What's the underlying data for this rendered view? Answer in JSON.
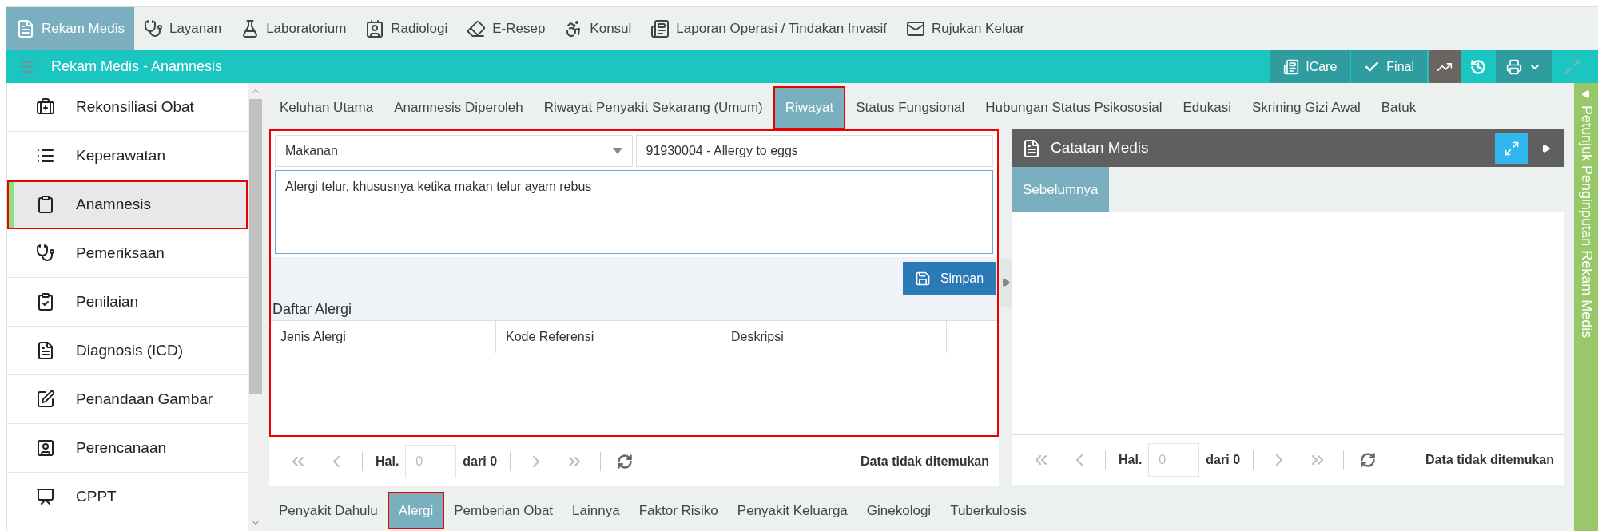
{
  "nav": [
    {
      "label": "Rekam Medis",
      "selected": true
    },
    {
      "label": "Layanan",
      "selected": false
    },
    {
      "label": "Laboratorium",
      "selected": false
    },
    {
      "label": "Radiologi",
      "selected": false
    },
    {
      "label": "E-Resep",
      "selected": false
    },
    {
      "label": "Konsul",
      "selected": false
    },
    {
      "label": "Laporan Operasi / Tindakan Invasif",
      "selected": false
    },
    {
      "label": "Rujukan Keluar",
      "selected": false
    }
  ],
  "header": {
    "title": "Rekam Medis - Anamnesis",
    "buttons": [
      "ICare",
      "Final"
    ]
  },
  "sidebar": {
    "items": [
      {
        "label": "Rekonsiliasi Obat",
        "selected": false
      },
      {
        "label": "Keperawatan",
        "selected": false
      },
      {
        "label": "Anamnesis",
        "selected": true
      },
      {
        "label": "Pemeriksaan",
        "selected": false
      },
      {
        "label": "Penilaian",
        "selected": false
      },
      {
        "label": "Diagnosis (ICD)",
        "selected": false
      },
      {
        "label": "Penandaan Gambar",
        "selected": false
      },
      {
        "label": "Perencanaan",
        "selected": false
      },
      {
        "label": "CPPT",
        "selected": false
      }
    ]
  },
  "tabs": [
    {
      "label": "Keluhan Utama",
      "selected": false
    },
    {
      "label": "Anamnesis Diperoleh",
      "selected": false
    },
    {
      "label": "Riwayat Penyakit Sekarang (Umum)",
      "selected": false
    },
    {
      "label": "Riwayat",
      "selected": true
    },
    {
      "label": "Status Fungsional",
      "selected": false
    },
    {
      "label": "Hubungan Status Psikososial",
      "selected": false
    },
    {
      "label": "Edukasi",
      "selected": false
    },
    {
      "label": "Skrining Gizi Awal",
      "selected": false
    },
    {
      "label": "Batuk",
      "selected": false
    }
  ],
  "form": {
    "type": "Makanan",
    "reference": "91930004 - Allergy to eggs",
    "description": "Alergi telur, khususnya ketika makan telur ayam rebus",
    "save": "Simpan"
  },
  "allergy_list": {
    "title": "Daftar Alergi",
    "columns": [
      "Jenis Alergi",
      "Kode Referensi",
      "Deskripsi"
    ]
  },
  "pagination": {
    "page_label": "Hal.",
    "page": "0",
    "of": "dari 0",
    "status": "Data tidak ditemukan"
  },
  "sub_tabs": [
    {
      "label": "Penyakit Dahulu",
      "selected": false
    },
    {
      "label": "Alergi",
      "selected": true
    },
    {
      "label": "Pemberian Obat",
      "selected": false
    },
    {
      "label": "Lainnya",
      "selected": false
    },
    {
      "label": "Faktor Risiko",
      "selected": false
    },
    {
      "label": "Penyakit Keluarga",
      "selected": false
    },
    {
      "label": "Ginekologi",
      "selected": false
    },
    {
      "label": "Tuberkulosis",
      "selected": false
    }
  ],
  "notes": {
    "title": "Catatan Medis",
    "tabs": [
      {
        "label": "Sebelumnya",
        "selected": true
      }
    ],
    "pagination": {
      "page_label": "Hal.",
      "page": "0",
      "of": "dari 0",
      "status": "Data tidak ditemukan"
    }
  },
  "side_hint": "Petunjuk Penginputan Rekam Medis"
}
